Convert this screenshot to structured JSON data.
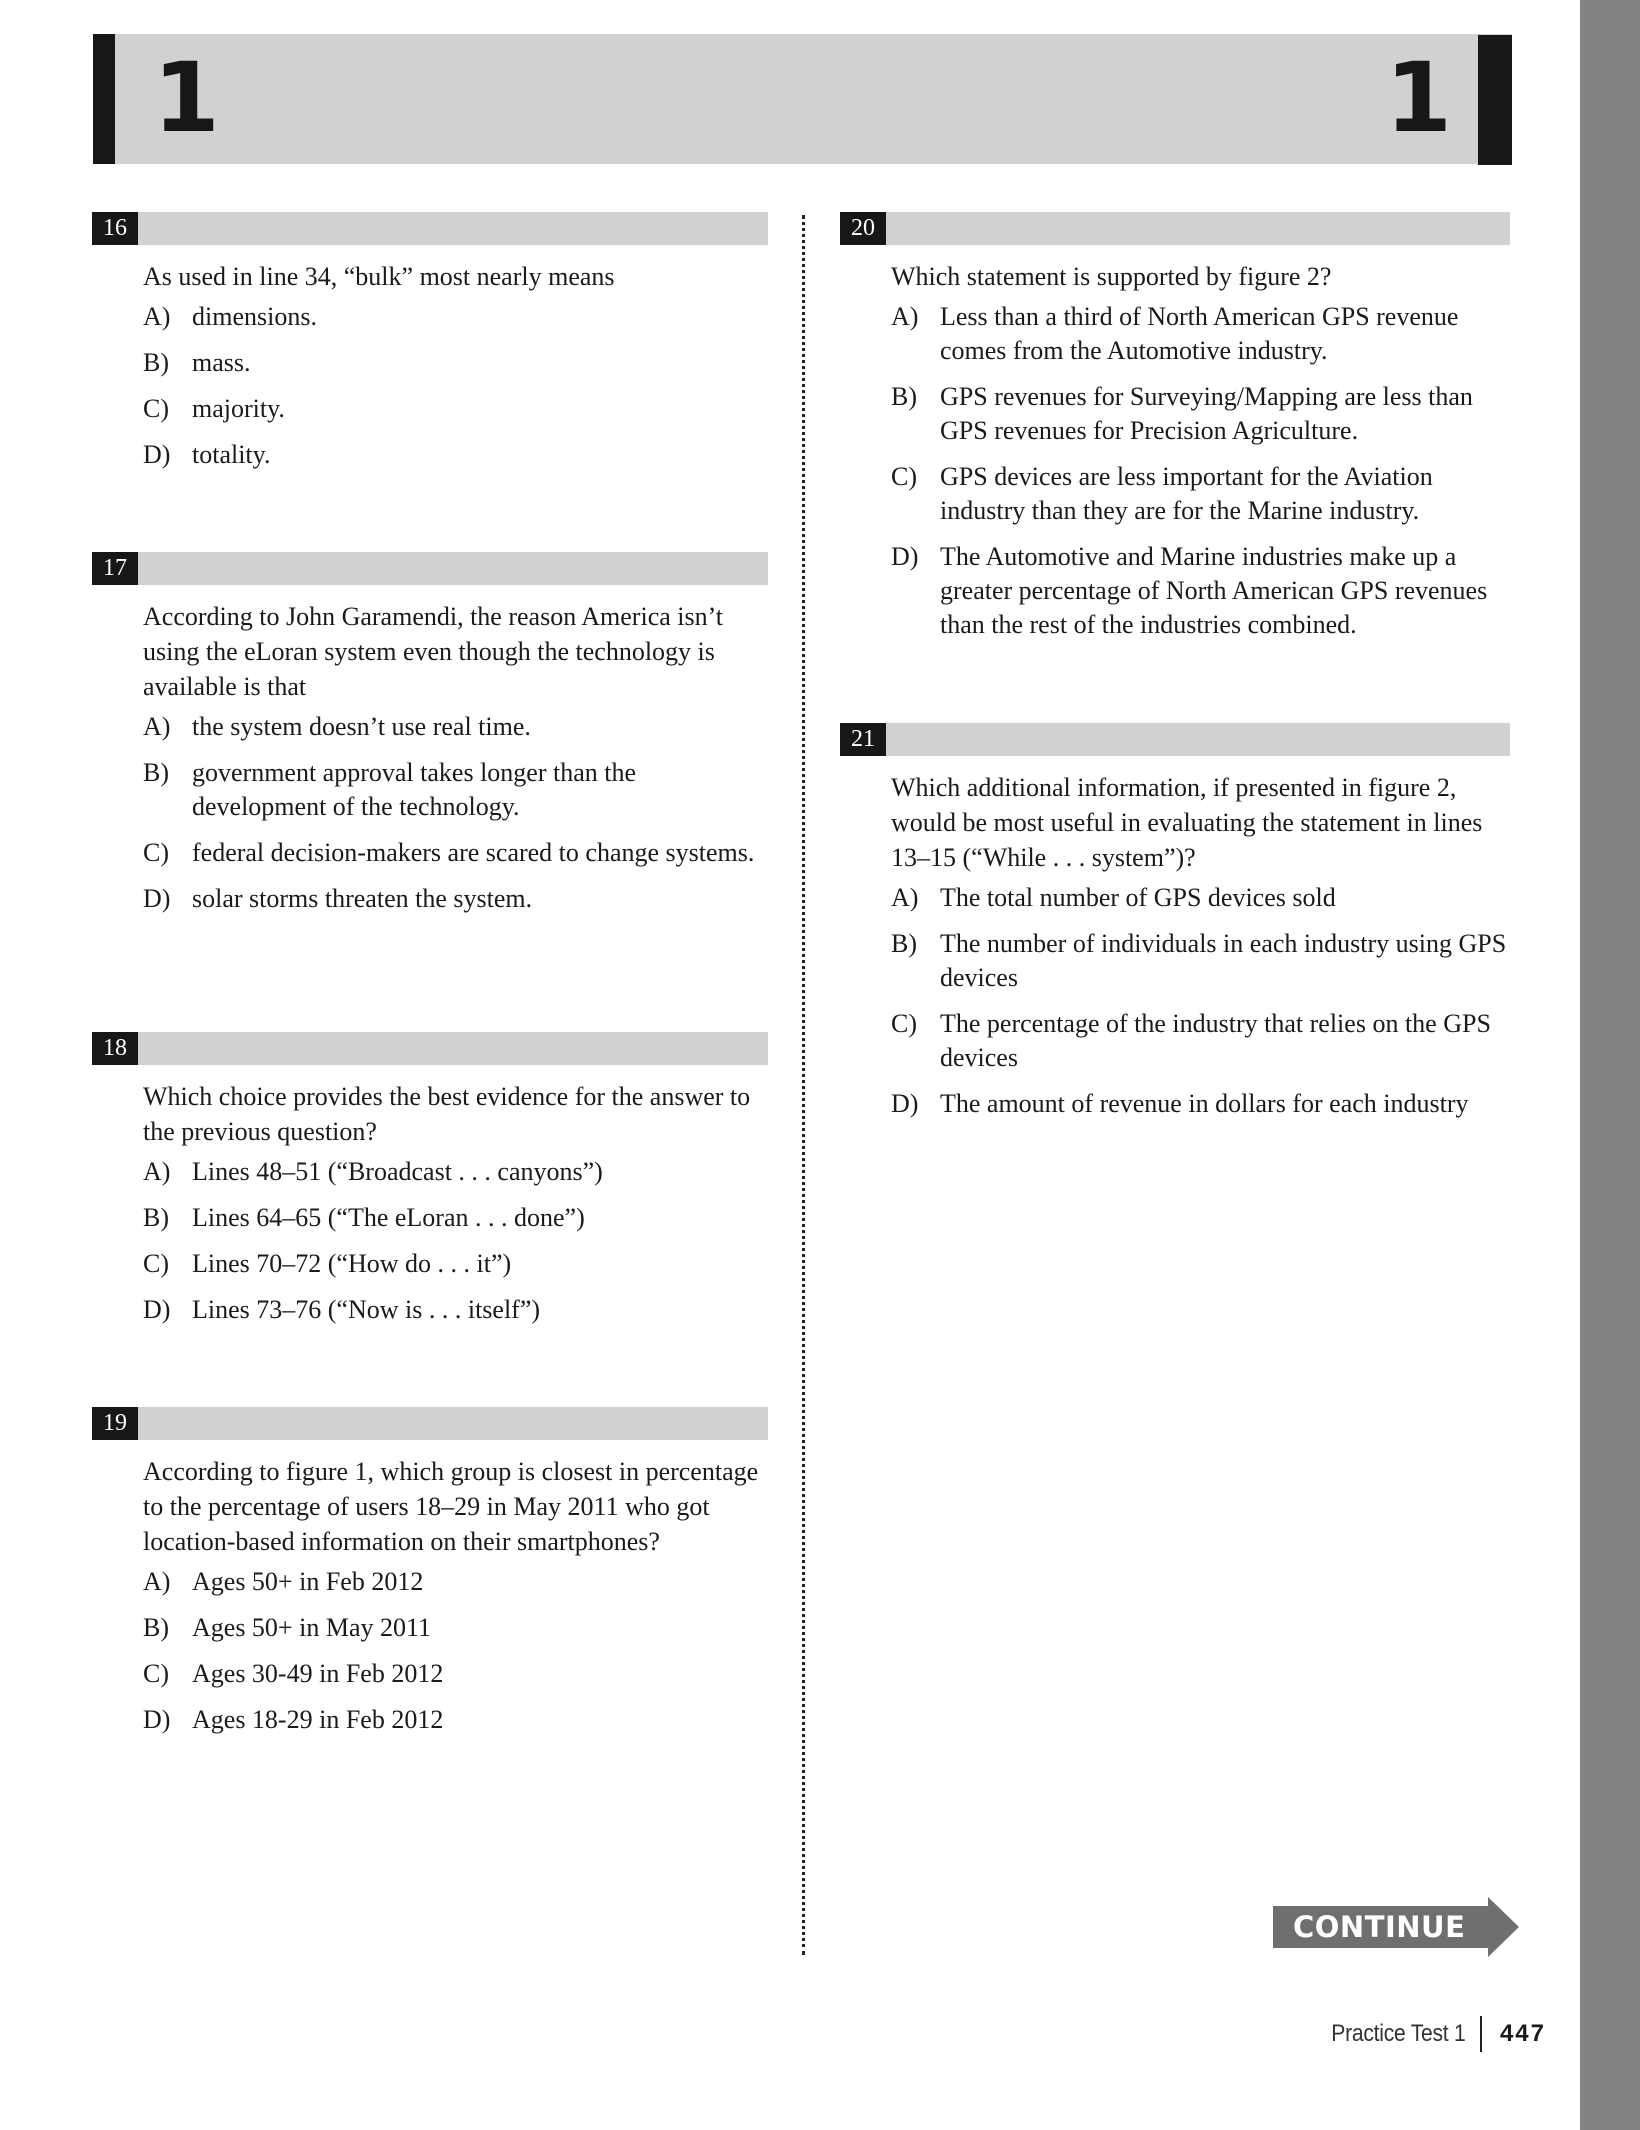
{
  "section": {
    "number_left": "1",
    "number_right": "1"
  },
  "questions": [
    {
      "number": "16",
      "stem": "As used in line 34, “bulk” most nearly means",
      "choices": [
        {
          "letter": "A)",
          "text": "dimensions."
        },
        {
          "letter": "B)",
          "text": "mass."
        },
        {
          "letter": "C)",
          "text": "majority."
        },
        {
          "letter": "D)",
          "text": "totality."
        }
      ]
    },
    {
      "number": "17",
      "stem": "According to John Garamendi, the reason America isn’t using the eLoran system even though the technology is available is that",
      "choices": [
        {
          "letter": "A)",
          "text": "the system doesn’t use real time."
        },
        {
          "letter": "B)",
          "text": "government approval takes longer than the development of the technology."
        },
        {
          "letter": "C)",
          "text": "federal decision-makers are scared to change systems."
        },
        {
          "letter": "D)",
          "text": "solar storms threaten the system."
        }
      ]
    },
    {
      "number": "18",
      "stem": "Which choice provides the best evidence for the answer to the previous question?",
      "choices": [
        {
          "letter": "A)",
          "text": "Lines 48–51 (“Broadcast . . . canyons”)"
        },
        {
          "letter": "B)",
          "text": "Lines 64–65 (“The eLoran . . . done”)"
        },
        {
          "letter": "C)",
          "text": "Lines 70–72 (“How do . . . it”)"
        },
        {
          "letter": "D)",
          "text": "Lines 73–76 (“Now is . . . itself”)"
        }
      ]
    },
    {
      "number": "19",
      "stem": "According to figure 1, which group is closest in percentage to the percentage of users 18–29 in May 2011 who got location-based information on their smartphones?",
      "choices": [
        {
          "letter": "A)",
          "text": "Ages 50+ in Feb 2012"
        },
        {
          "letter": "B)",
          "text": "Ages 50+ in May 2011"
        },
        {
          "letter": "C)",
          "text": "Ages 30-49 in Feb 2012"
        },
        {
          "letter": "D)",
          "text": "Ages 18-29 in Feb 2012"
        }
      ]
    },
    {
      "number": "20",
      "stem": "Which statement is supported by figure 2?",
      "choices": [
        {
          "letter": "A)",
          "text": "Less than a third of North American GPS revenue comes from the Automotive industry."
        },
        {
          "letter": "B)",
          "text": "GPS revenues for Surveying/Mapping are less than GPS revenues for Precision Agriculture."
        },
        {
          "letter": "C)",
          "text": "GPS devices are less important for the Aviation industry than they are for the Marine industry."
        },
        {
          "letter": "D)",
          "text": "The Automotive and Marine industries make up a greater percentage of North American GPS revenues than the rest of the industries combined."
        }
      ]
    },
    {
      "number": "21",
      "stem": "Which additional information, if presented in figure 2, would be most useful in evaluating the statement in lines 13–15 (“While . . . system”)?",
      "choices": [
        {
          "letter": "A)",
          "text": "The total number of GPS devices sold"
        },
        {
          "letter": "B)",
          "text": "The number of individuals in each industry using GPS devices"
        },
        {
          "letter": "C)",
          "text": "The percentage of the industry that relies on the GPS devices"
        },
        {
          "letter": "D)",
          "text": "The amount of revenue in dollars for each industry"
        }
      ]
    }
  ],
  "continue_label": "CONTINUE",
  "footer": {
    "title": "Practice Test 1",
    "page": "447"
  },
  "colors": {
    "header_gray": "#d1d1d1",
    "number_black": "#171715",
    "side_strip": "#838383",
    "continue_gray": "#6f6f6f"
  }
}
